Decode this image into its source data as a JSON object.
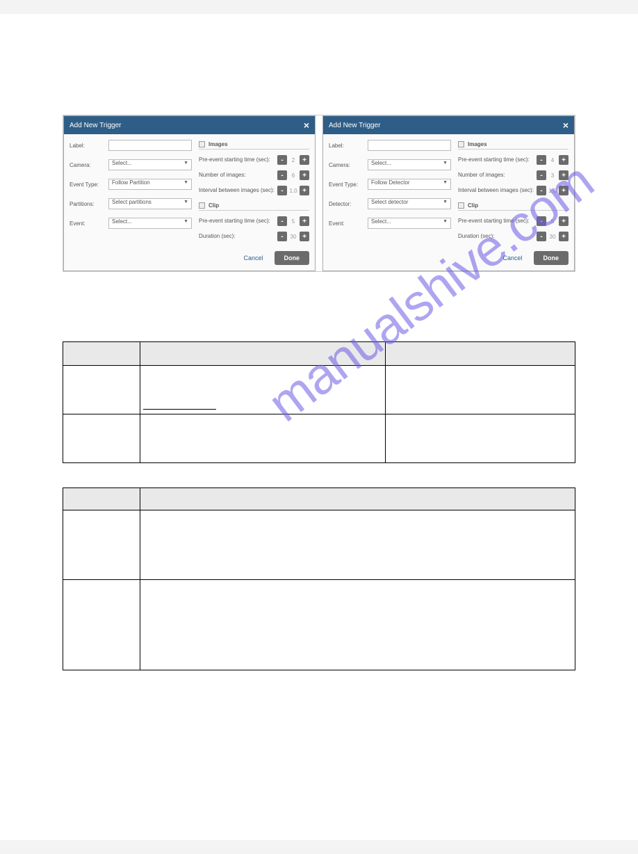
{
  "watermark": "manualshive.com",
  "dialogs": [
    {
      "title": "Add New Trigger",
      "fields": {
        "label_label": "Label:",
        "camera_label": "Camera:",
        "camera_value": "Select...",
        "eventtype_label": "Event Type:",
        "eventtype_value": "Follow Partition",
        "partitions_label": "Partitions:",
        "partitions_value": "Select partitions",
        "event_label": "Event:",
        "event_value": "Select..."
      },
      "images_section": "Images",
      "clip_section": "Clip",
      "opts": {
        "preevent": "Pre-event starting time (sec):",
        "preevent_val": "2",
        "num_images": "Number of images:",
        "num_images_val": "6",
        "interval": "Interval between images (sec):",
        "interval_val": "1.0",
        "clip_preevent": "Pre-event starting time (sec):",
        "clip_preevent_val": "5",
        "duration": "Duration (sec):",
        "duration_val": "30"
      },
      "cancel": "Cancel",
      "done": "Done"
    },
    {
      "title": "Add New Trigger",
      "fields": {
        "label_label": "Label:",
        "camera_label": "Camera:",
        "camera_value": "Select...",
        "eventtype_label": "Event Type:",
        "eventtype_value": "Follow Detector",
        "detector_label": "Detector:",
        "detector_value": "Select detector",
        "event_label": "Event:",
        "event_value": "Select..."
      },
      "images_section": "Images",
      "clip_section": "Clip",
      "opts": {
        "preevent": "Pre-event starting time (sec):",
        "preevent_val": "4",
        "num_images": "Number of images:",
        "num_images_val": "3",
        "interval": "Interval between images (sec):",
        "interval_val": "1.0",
        "clip_preevent": "Pre-event starting time (sec):",
        "clip_preevent_val": "5",
        "duration": "Duration (sec):",
        "duration_val": "30"
      },
      "cancel": "Cancel",
      "done": "Done"
    }
  ]
}
